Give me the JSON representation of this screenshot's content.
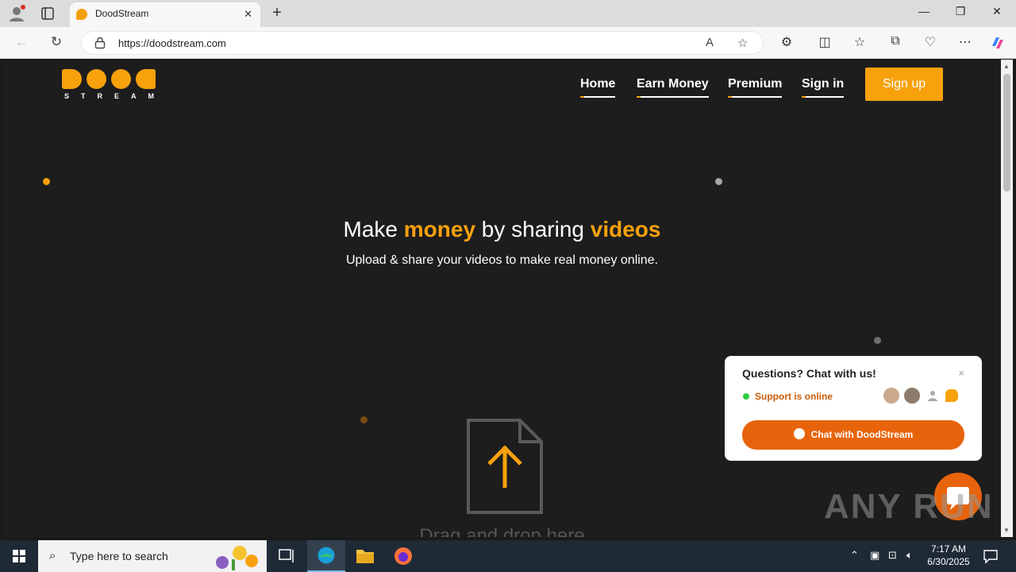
{
  "browser": {
    "tab_title": "DoodStream",
    "url": "https://doodstream.com",
    "close_tab": "✕",
    "new_tab": "+",
    "window_controls": [
      "—",
      "❐",
      "✕"
    ]
  },
  "site": {
    "logo_text": "STREAM",
    "nav": [
      {
        "label": "Home"
      },
      {
        "label": "Earn Money"
      },
      {
        "label": "Premium"
      },
      {
        "label": "Sign in"
      }
    ],
    "signup_label": "Sign up",
    "hero": {
      "title_1": "Make ",
      "title_2": "money",
      "title_3": " by sharing ",
      "title_4": "videos",
      "subtitle": "Upload & share your videos to make real money online."
    },
    "drop_text": "Drag and drop here"
  },
  "chat": {
    "title": "Questions? Chat with us!",
    "close": "×",
    "status": "Support is online",
    "button_label": "Chat with DoodStream"
  },
  "watermark": "ANY RUN",
  "taskbar": {
    "search_placeholder": "Type here to search",
    "time": "7:17 AM",
    "date": "6/30/2025"
  },
  "colors": {
    "accent": "#f7a10c",
    "chat_orange": "#e8640c",
    "page_bg": "#1d1d1e"
  }
}
